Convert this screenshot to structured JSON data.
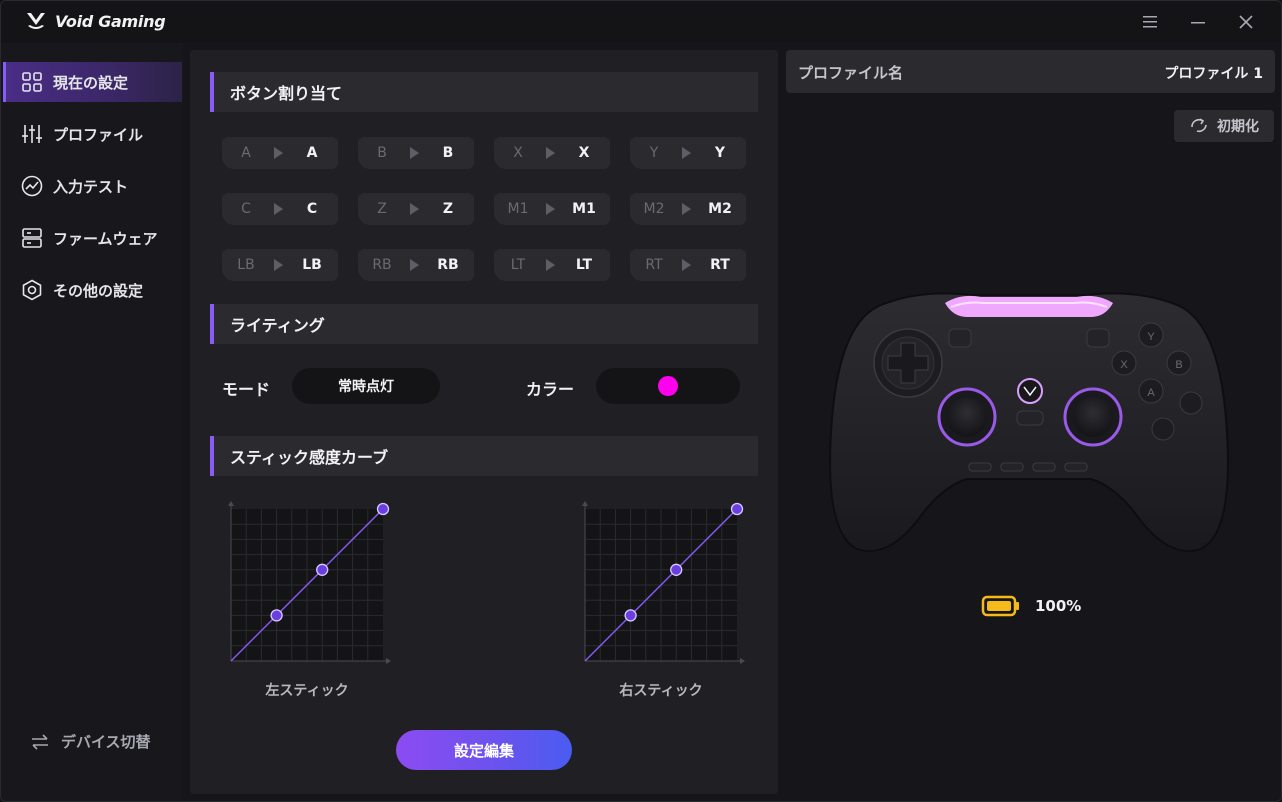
{
  "app": {
    "title": "Void Gaming"
  },
  "window_controls": {
    "menu": "menu-icon",
    "minimize": "minimize-icon",
    "close": "close-icon"
  },
  "sidebar": {
    "items": [
      {
        "label": "現在の設定",
        "icon": "grid-icon",
        "active": true
      },
      {
        "label": "プロファイル",
        "icon": "sliders-icon",
        "active": false
      },
      {
        "label": "入力テスト",
        "icon": "chart-circle-icon",
        "active": false
      },
      {
        "label": "ファームウェア",
        "icon": "server-icon",
        "active": false
      },
      {
        "label": "その他の設定",
        "icon": "hexagon-settings-icon",
        "active": false
      }
    ],
    "device_switch": {
      "label": "デバイス切替",
      "icon": "swap-icon"
    }
  },
  "button_mapping": {
    "title": "ボタン割り当て",
    "rows": [
      [
        {
          "from": "A",
          "to": "A"
        },
        {
          "from": "B",
          "to": "B"
        },
        {
          "from": "X",
          "to": "X"
        },
        {
          "from": "Y",
          "to": "Y"
        }
      ],
      [
        {
          "from": "C",
          "to": "C"
        },
        {
          "from": "Z",
          "to": "Z"
        },
        {
          "from": "M1",
          "to": "M1"
        },
        {
          "from": "M2",
          "to": "M2"
        }
      ],
      [
        {
          "from": "LB",
          "to": "LB"
        },
        {
          "from": "RB",
          "to": "RB"
        },
        {
          "from": "LT",
          "to": "LT"
        },
        {
          "from": "RT",
          "to": "RT"
        }
      ]
    ]
  },
  "lighting": {
    "title": "ライティング",
    "mode_label": "モード",
    "mode_value": "常時点灯",
    "color_label": "カラー",
    "color": "#ff00ee"
  },
  "stick_curve": {
    "title": "スティック感度カーブ",
    "left_label": "左スティック",
    "right_label": "右スティック",
    "points": [
      [
        0.3,
        0.3
      ],
      [
        0.6,
        0.6
      ],
      [
        1.0,
        1.0
      ]
    ]
  },
  "edit_button": {
    "label": "設定編集"
  },
  "profile": {
    "name_label": "プロファイル名",
    "name_value": "プロファイル 1",
    "reset_label": "初期化"
  },
  "battery": {
    "value": "100%",
    "color": "#f5b91a"
  },
  "colors": {
    "accent": "#8a5cf6",
    "light_bar": "#f0a8ff"
  }
}
